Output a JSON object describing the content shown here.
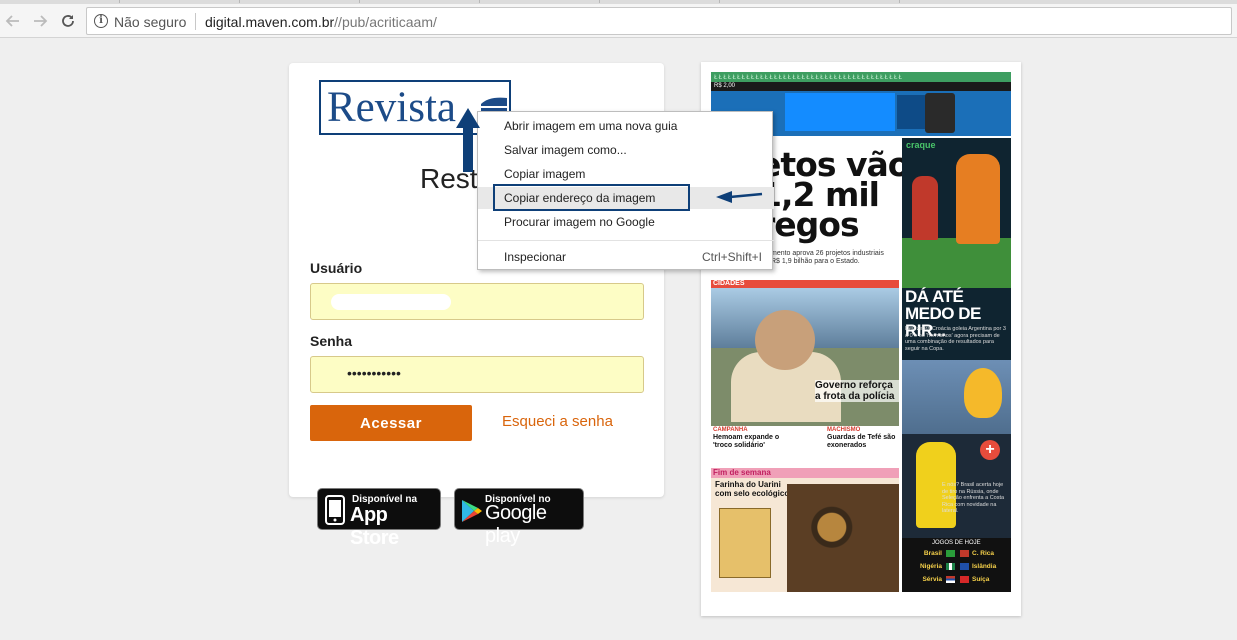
{
  "browser": {
    "secure_label": "Não seguro",
    "url_host": "digital.maven.com.br",
    "url_path": "//pub/acriticaam/"
  },
  "login": {
    "logo_text": "Revista",
    "title": "Rest",
    "user_label": "Usuário",
    "password_label": "Senha",
    "password_value": "•••••••••••",
    "submit_label": "Acessar",
    "forgot_label": "Esqueci a senha"
  },
  "stores": {
    "apple_small": "Disponível na",
    "apple_big": "App Store",
    "google_small": "Disponível no",
    "google_big": "Google play"
  },
  "context_menu": {
    "items": [
      {
        "label": "Abrir imagem em uma nova guia",
        "shortcut": ""
      },
      {
        "label": "Salvar imagem como...",
        "shortcut": ""
      },
      {
        "label": "Copiar imagem",
        "shortcut": ""
      },
      {
        "label": "Copiar endereço da imagem",
        "shortcut": ""
      },
      {
        "label": "Procurar imagem no Google",
        "shortcut": ""
      },
      {
        "label": "Inspecionar",
        "shortcut": "Ctrl+Shift+I"
      }
    ],
    "highlighted_index": 3
  },
  "newspaper": {
    "price": "R$ 2,00",
    "headline": "etos vão\n1,2 mil\nregos",
    "subhead": "mento aprova 26 projetos industriais\nR$ 1,9 bilhão para o Estado.",
    "cidades_tag": "CIDADES",
    "cidades_headline": "Governo reforça a frota da polícia",
    "box1_kicker": "CAMPANHA",
    "box1_head": "Hemoam expande o 'troco solidário'",
    "box2_kicker": "MACHISMO",
    "box2_head": "Guardas de Tefé são exonerados",
    "fim_tag": "Fim de semana",
    "fim_head": "Farinha do Uarini com selo ecológico",
    "craque_logo": "craque",
    "craque_headline": "DÁ ATÉ MEDO DE RIR...",
    "craque_text": "Deu zebra Croácia goleia Argentina por 3 a 0 e os 'hermanos' agora precisam de uma combinação de resultados para seguir na Copa.",
    "brasil_text": "E nós? Brasil acerta hoje de tiro na Rússia, onde Seleção enfrenta a Costa Rica com novidade na lateral.",
    "jogos_title": "JOGOS DE HOJE",
    "jogos": [
      {
        "a": "Brasil",
        "b": "C. Rica"
      },
      {
        "a": "Nigéria",
        "b": "Islândia"
      },
      {
        "a": "Sérvia",
        "b": "Suíça"
      }
    ]
  }
}
